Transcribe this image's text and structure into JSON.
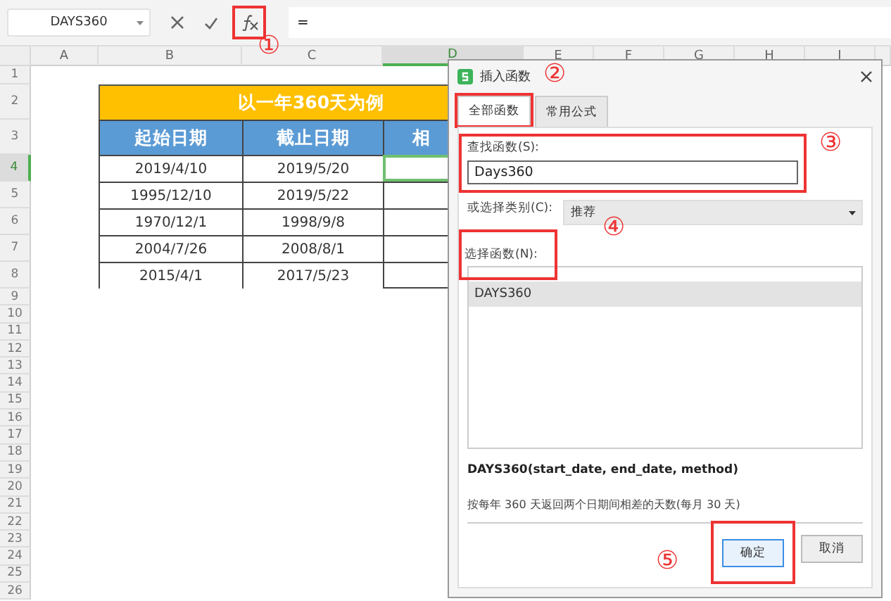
{
  "formula_bar": {
    "name_box": "DAYS360",
    "formula": "="
  },
  "columns": [
    {
      "label": "A",
      "selected": false
    },
    {
      "label": "B",
      "selected": false
    },
    {
      "label": "C",
      "selected": false
    },
    {
      "label": "D",
      "selected": true
    },
    {
      "label": "E",
      "selected": false
    },
    {
      "label": "F",
      "selected": false
    },
    {
      "label": "G",
      "selected": false
    },
    {
      "label": "H",
      "selected": false
    },
    {
      "label": "I",
      "selected": false
    }
  ],
  "rows": [
    {
      "label": "1",
      "selected": false
    },
    {
      "label": "2",
      "selected": false
    },
    {
      "label": "3",
      "selected": false
    },
    {
      "label": "4",
      "selected": true
    },
    {
      "label": "5",
      "selected": false
    },
    {
      "label": "6",
      "selected": false
    },
    {
      "label": "7",
      "selected": false
    },
    {
      "label": "8",
      "selected": false
    },
    {
      "label": "9",
      "selected": false
    },
    {
      "label": "10",
      "selected": false
    },
    {
      "label": "11",
      "selected": false
    },
    {
      "label": "12",
      "selected": false
    },
    {
      "label": "13",
      "selected": false
    },
    {
      "label": "14",
      "selected": false
    },
    {
      "label": "15",
      "selected": false
    },
    {
      "label": "16",
      "selected": false
    },
    {
      "label": "17",
      "selected": false
    },
    {
      "label": "18",
      "selected": false
    },
    {
      "label": "19",
      "selected": false
    },
    {
      "label": "20",
      "selected": false
    },
    {
      "label": "21",
      "selected": false
    },
    {
      "label": "22",
      "selected": false
    },
    {
      "label": "23",
      "selected": false
    },
    {
      "label": "24",
      "selected": false
    },
    {
      "label": "25",
      "selected": false
    },
    {
      "label": "26",
      "selected": false
    }
  ],
  "table": {
    "title": "以一年360天为例",
    "headers": [
      "起始日期",
      "截止日期",
      "相"
    ],
    "rows": [
      [
        "2019/4/10",
        "2019/5/20"
      ],
      [
        "1995/12/10",
        "2019/5/22"
      ],
      [
        "1970/12/1",
        "1998/9/8"
      ],
      [
        "2004/7/26",
        "2008/8/1"
      ],
      [
        "2015/4/1",
        "2017/5/23"
      ]
    ]
  },
  "dialog": {
    "title": "插入函数",
    "tabs": [
      {
        "label": "全部函数",
        "selected": true
      },
      {
        "label": "常用公式",
        "selected": false
      }
    ],
    "search_label": "查找函数(S):",
    "search_value": "Days360",
    "category_label": "或选择类别(C):",
    "category_value": "推荐",
    "list_label": "选择函数(N):",
    "functions": [
      {
        "label": "DAYS360",
        "selected": true
      }
    ],
    "signature": "DAYS360(start_date, end_date, method)",
    "description": "按每年 360 天返回两个日期间相差的天数(每月 30 天)",
    "buttons": [
      "确定",
      "取消"
    ]
  },
  "annotations": [
    "①",
    "②",
    "③",
    "④",
    "⑤"
  ]
}
